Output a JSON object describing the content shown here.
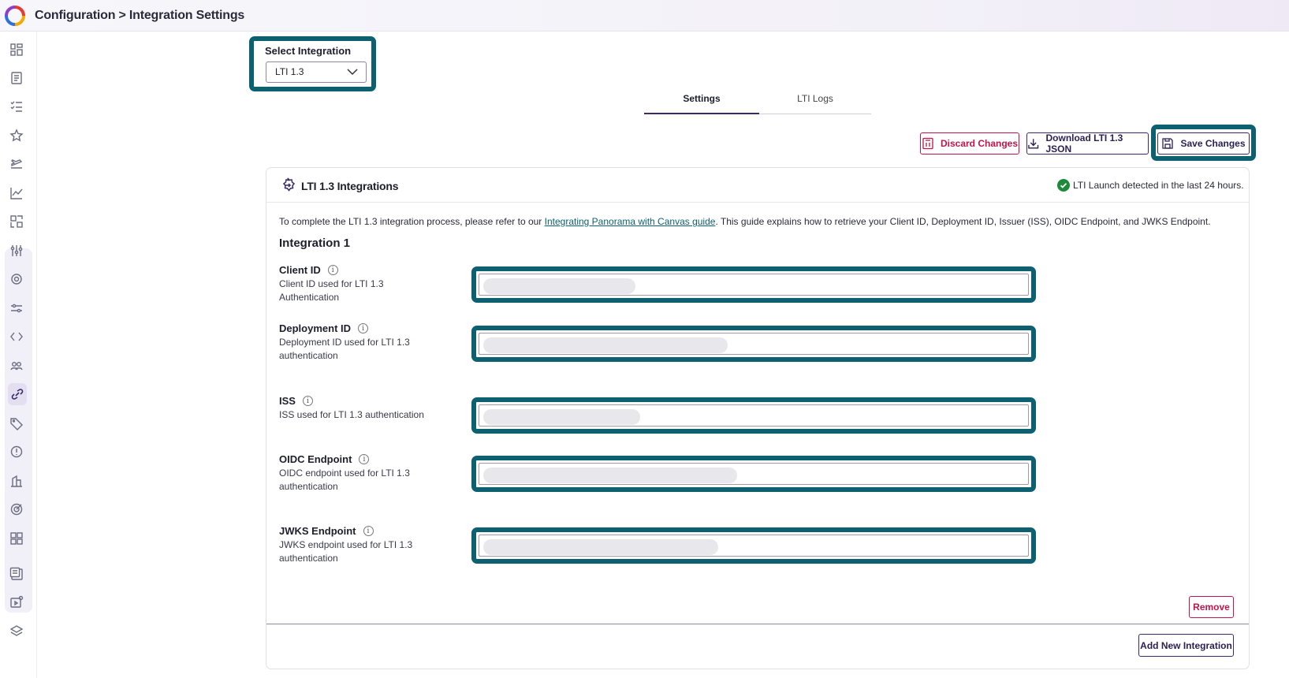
{
  "header": {
    "breadcrumb": "Configuration > Integration Settings"
  },
  "sidebar": {
    "items": [
      "grid-icon",
      "document-icon",
      "checklist-icon",
      "star-icon",
      "plane-icon",
      "chart-line-icon",
      "qr-icon",
      "sliders-icon",
      "gear-icon",
      "tune-icon",
      "code-icon",
      "users-icon",
      "link-icon",
      "tag-icon",
      "alert-icon",
      "building-icon",
      "target-icon",
      "apps-icon",
      "report-icon",
      "media-icon",
      "layers-icon"
    ],
    "active": "link-icon"
  },
  "select_integration": {
    "label": "Select Integration",
    "value": "LTI 1.3"
  },
  "tabs": [
    {
      "label": "Settings",
      "active": true
    },
    {
      "label": "LTI Logs",
      "active": false
    }
  ],
  "actions": {
    "discard": "Discard Changes",
    "download": "Download LTI 1.3 JSON",
    "save": "Save Changes"
  },
  "card": {
    "title": "LTI 1.3 Integrations",
    "status": "LTI Launch detected in the last 24 hours.",
    "intro_before": "To complete the LTI 1.3 integration process, please refer to our ",
    "intro_link": "Integrating Panorama with Canvas guide",
    "intro_after": ". This guide explains how to retrieve your Client ID, Deployment ID, Issuer (ISS), OIDC Endpoint, and JWKS Endpoint.",
    "integration_title": "Integration 1",
    "fields": [
      {
        "label": "Client ID",
        "desc": "Client ID used for LTI 1.3 Authentication"
      },
      {
        "label": "Deployment ID",
        "desc": "Deployment ID used for LTI 1.3 authentication"
      },
      {
        "label": "ISS",
        "desc": "ISS used for LTI 1.3 authentication"
      },
      {
        "label": "OIDC Endpoint",
        "desc": "OIDC endpoint used for LTI 1.3 authentication"
      },
      {
        "label": "JWKS Endpoint",
        "desc": "JWKS endpoint used for LTI 1.3 authentication"
      }
    ],
    "remove": "Remove",
    "add_new": "Add New Integration"
  },
  "colors": {
    "highlight": "#0d6070",
    "danger": "#c0154a",
    "primary": "#3a2a6a",
    "success": "#1d8a3a"
  }
}
